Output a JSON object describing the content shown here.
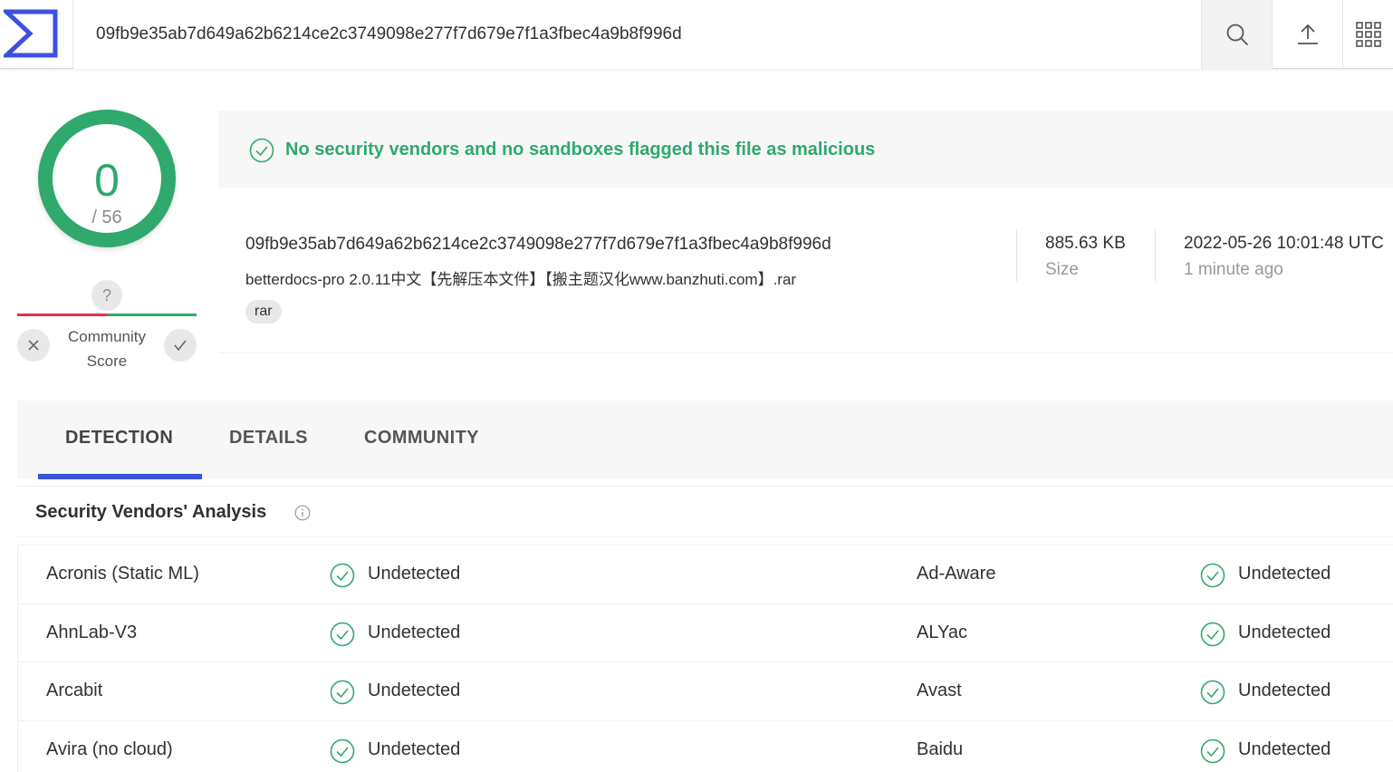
{
  "header": {
    "search_value": "09fb9e35ab7d649a62b6214ce2c3749098e277f7d679e7f1a3fbec4a9b8f996d",
    "icons": [
      "logo-icon",
      "search-icon",
      "upload-icon",
      "apps-grid-icon"
    ]
  },
  "score": {
    "detections": "0",
    "total": "/ 56",
    "color": "#2fa96e"
  },
  "community": {
    "label_line1": "Community",
    "label_line2": "Score",
    "unknown": "?"
  },
  "banner": {
    "text": "No security vendors and no sandboxes flagged this file as malicious"
  },
  "file": {
    "hash": "09fb9e35ab7d649a62b6214ce2c3749098e277f7d679e7f1a3fbec4a9b8f996d",
    "name": "betterdocs-pro 2.0.11中文【先解压本文件】【搬主题汉化www.banzhuti.com】.rar",
    "tag": "rar",
    "size_value": "885.63 KB",
    "size_label": "Size",
    "date_value": "2022-05-26 10:01:48 UTC",
    "date_label": "1 minute ago"
  },
  "tabs": [
    "DETECTION",
    "DETAILS",
    "COMMUNITY"
  ],
  "analysis": {
    "title": "Security Vendors' Analysis",
    "rows": [
      {
        "v1": "Acronis (Static ML)",
        "r1": "Undetected",
        "v2": "Ad-Aware",
        "r2": "Undetected"
      },
      {
        "v1": "AhnLab-V3",
        "r1": "Undetected",
        "v2": "ALYac",
        "r2": "Undetected"
      },
      {
        "v1": "Arcabit",
        "r1": "Undetected",
        "v2": "Avast",
        "r2": "Undetected"
      },
      {
        "v1": "Avira (no cloud)",
        "r1": "Undetected",
        "v2": "Baidu",
        "r2": "Undetected"
      }
    ]
  },
  "colors": {
    "accent": "#3a51e0",
    "clean": "#2fa96e",
    "malicious": "#e0314b"
  }
}
